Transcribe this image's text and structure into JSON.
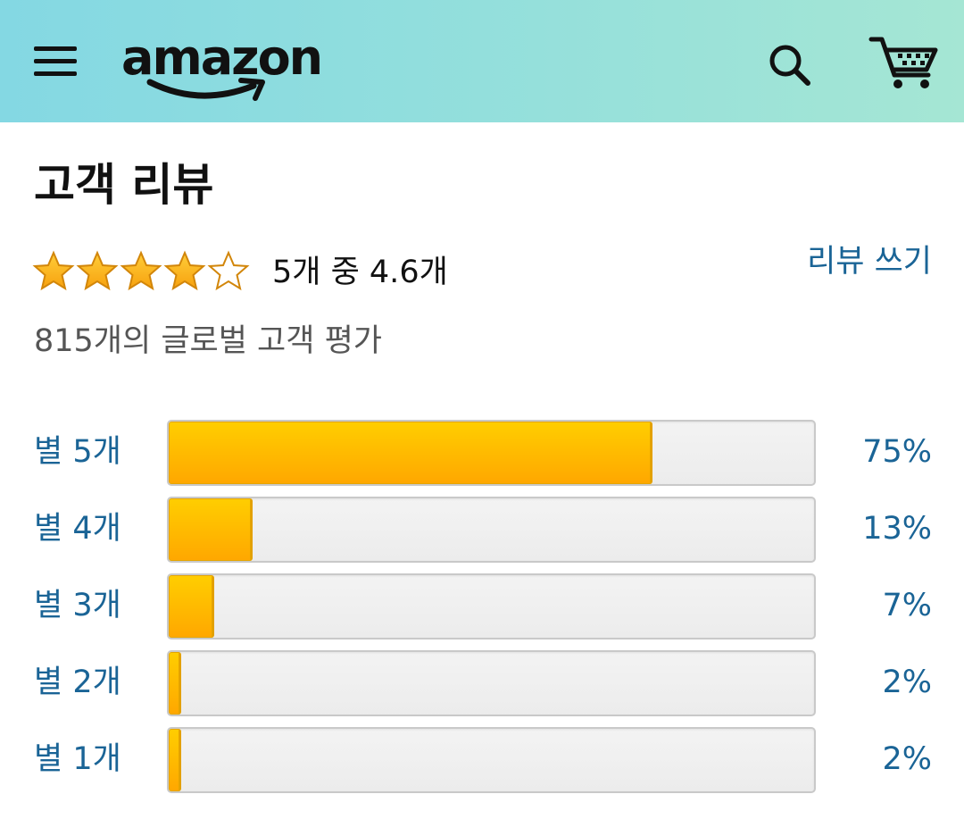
{
  "header": {
    "logo_text": "amazon",
    "menu_icon": "hamburger-menu-icon",
    "search_icon": "search-icon",
    "cart_icon": "cart-icon",
    "background_from": "#84d8e3",
    "background_to": "#a5e6d4"
  },
  "reviews": {
    "title": "고객 리뷰",
    "average_rating": 4.6,
    "rating_text": "5개 중 4.6개",
    "write_review_label": "리뷰 쓰기",
    "global_ratings_text": "815개의 글로벌 고객 평가",
    "star_color": "#ffa41c",
    "link_color": "#1a6496",
    "histogram": [
      {
        "label": "별 5개",
        "percent": 75,
        "percent_text": "75%"
      },
      {
        "label": "별 4개",
        "percent": 13,
        "percent_text": "13%"
      },
      {
        "label": "별 3개",
        "percent": 7,
        "percent_text": "7%"
      },
      {
        "label": "별 2개",
        "percent": 2,
        "percent_text": "2%"
      },
      {
        "label": "별 1개",
        "percent": 2,
        "percent_text": "2%"
      }
    ]
  }
}
